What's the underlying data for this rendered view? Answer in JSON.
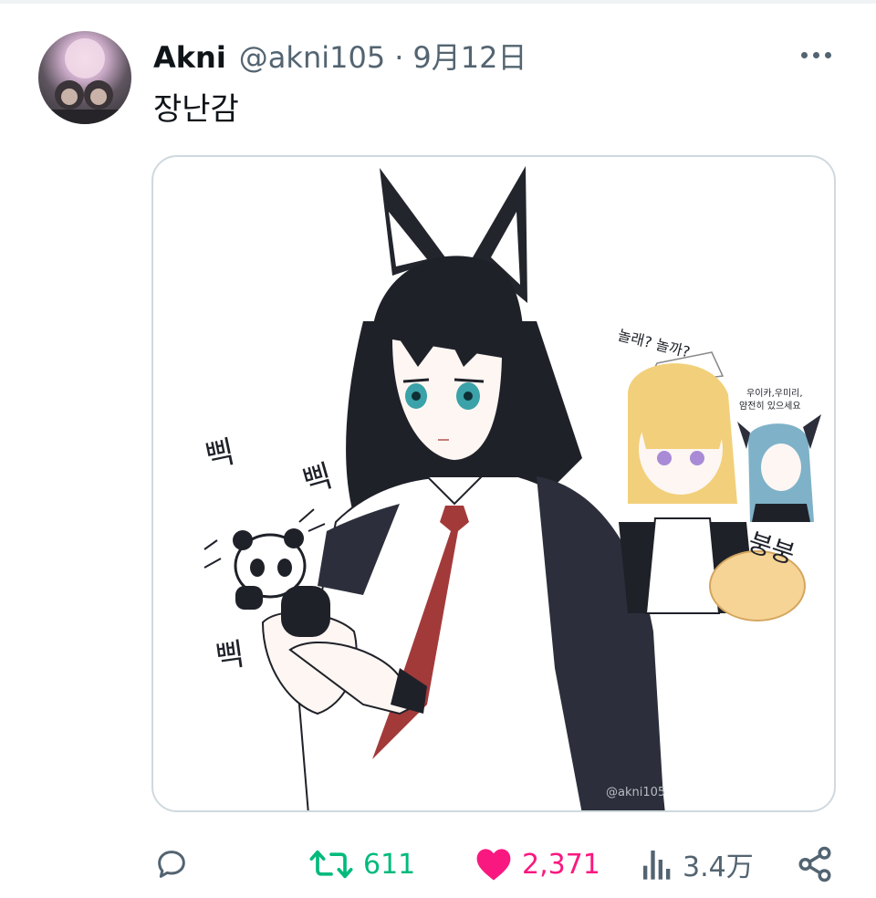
{
  "tweet": {
    "display_name": "Akni",
    "handle": "@akni105",
    "separator": "·",
    "date": "9月12日",
    "text": "장난감"
  },
  "media": {
    "sfx_text_1": "삑",
    "sfx_text_2": "삑",
    "sfx_text_3": "삑",
    "speech_text": "놀래? 놀까?",
    "side_text_line1": "우이카,우미리,",
    "side_text_line2": "얌전히 있으세요",
    "bounce_text": "붕붕",
    "watermark": "@akni105"
  },
  "actions": {
    "reply_count": "",
    "retweet_count": "611",
    "like_count": "2,371",
    "views_count": "3.4万"
  },
  "colors": {
    "text_primary": "#0f1419",
    "text_secondary": "#536471",
    "retweet_green": "#00ba7c",
    "like_pink": "#f91880",
    "border": "#cfd9de"
  },
  "icons": {
    "reply": "reply-icon",
    "retweet": "retweet-icon",
    "like": "heart-icon",
    "views": "views-icon",
    "share": "share-icon",
    "more": "more-icon"
  }
}
